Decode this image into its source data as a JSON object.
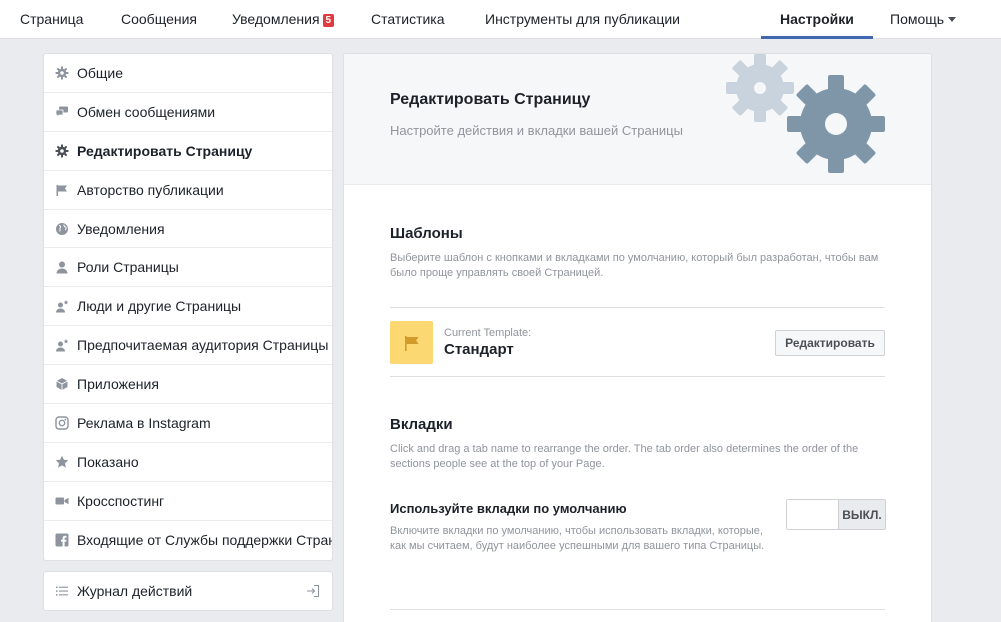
{
  "nav": {
    "items": [
      {
        "label": "Страница"
      },
      {
        "label": "Сообщения"
      },
      {
        "label": "Уведомления",
        "badge": "5"
      },
      {
        "label": "Статистика"
      },
      {
        "label": "Инструменты для публикации"
      },
      {
        "label": "Настройки",
        "active": true
      },
      {
        "label": "Помощь"
      }
    ]
  },
  "sidebar": {
    "items": [
      {
        "label": "Общие",
        "icon": "gear-icon"
      },
      {
        "label": "Обмен сообщениями",
        "icon": "chat-icon"
      },
      {
        "label": "Редактировать Страницу",
        "icon": "gear-icon",
        "active": true
      },
      {
        "label": "Авторство публикации",
        "icon": "flag-icon"
      },
      {
        "label": "Уведомления",
        "icon": "globe-icon"
      },
      {
        "label": "Роли Страницы",
        "icon": "person-icon"
      },
      {
        "label": "Люди и другие Страницы",
        "icon": "person-star-icon"
      },
      {
        "label": "Предпочитаемая аудитория Страницы",
        "icon": "person-star-icon"
      },
      {
        "label": "Приложения",
        "icon": "cube-icon"
      },
      {
        "label": "Реклама в Instagram",
        "icon": "instagram-icon"
      },
      {
        "label": "Показано",
        "icon": "star-icon"
      },
      {
        "label": "Кросспостинг",
        "icon": "video-camera-icon"
      },
      {
        "label": "Входящие от Службы поддержки Страниц",
        "icon": "facebook-icon"
      }
    ],
    "activity_log": {
      "label": "Журнал действий",
      "icon": "list-icon"
    }
  },
  "main": {
    "title": "Редактировать Страницу",
    "subtitle": "Настройте действия и вкладки вашей Страницы",
    "templates": {
      "title": "Шаблоны",
      "description": "Выберите шаблон с кнопками и вкладками по умолчанию, который был разработан, чтобы вам было проще управлять своей Страницей.",
      "current_label": "Current Template:",
      "current_value": "Стандарт",
      "edit_button": "Редактировать"
    },
    "tabs": {
      "title": "Вкладки",
      "description": "Click and drag a tab name to rearrange the order. The tab order also determines the order of the sections people see at the top of your Page.",
      "default_tabs": {
        "title": "Используйте вкладки по умолчанию",
        "description": "Включите вкладки по умолчанию, чтобы использовать вкладки, которые, как мы считаем, будут наиболее успешными для вашего типа Страницы.",
        "toggle_state": "ВЫКЛ."
      }
    }
  },
  "colors": {
    "accent": "#4267b2",
    "badge": "#e0393e",
    "template_icon_bg": "#fcd872",
    "gear_light": "#c8d3dd",
    "gear_dark": "#7f96a9"
  }
}
